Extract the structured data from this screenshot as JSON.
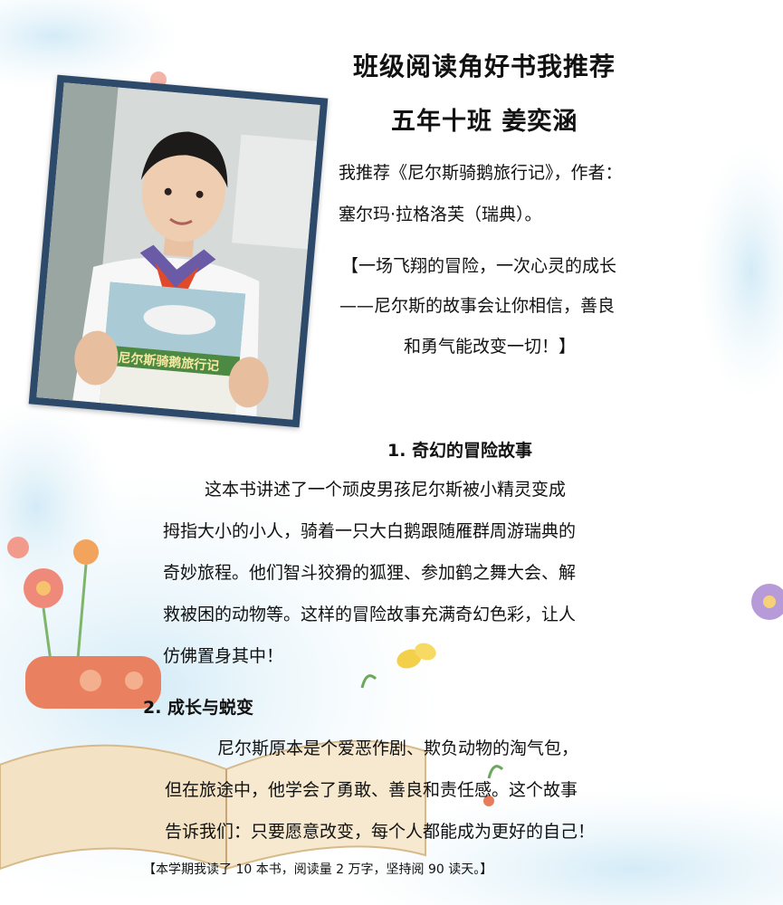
{
  "title": "班级阅读角好书我推荐",
  "subtitle": "五年十班  姜奕涵",
  "recommend": {
    "line1": "我推荐《尼尔斯骑鹅旅行记》，作者：",
    "line2": "塞尔玛·拉格洛芙（瑞典）。"
  },
  "quote": {
    "line1": "【一场飞翔的冒险，一次心灵的成长",
    "line2": "——尼尔斯的故事会让你相信，善良",
    "line3": "和勇气能改变一切！】"
  },
  "book_cover_title": "尼尔斯骑鹅旅行记",
  "sections": [
    {
      "heading": "1.  奇幻的冒险故事",
      "lines": [
        "这本书讲述了一个顽皮男孩尼尔斯被小精灵变成",
        "拇指大小的小人，骑着一只大白鹅跟随雁群周游瑞典的",
        "奇妙旅程。他们智斗狡猾的狐狸、参加鹤之舞大会、解",
        "救被困的动物等。这样的冒险故事充满奇幻色彩，让人",
        "仿佛置身其中！"
      ]
    },
    {
      "heading": "2. 成长与蜕变",
      "lines": [
        "尼尔斯原本是个爱恶作剧、欺负动物的淘气包，",
        "但在旅途中，他学会了勇敢、善良和责任感。这个故事",
        "告诉我们：只要愿意改变，每个人都能成为更好的自己！"
      ]
    }
  ],
  "footer": "【本学期我读了 10 本书，阅读量 2 万字，坚持阅 90 读天。】"
}
